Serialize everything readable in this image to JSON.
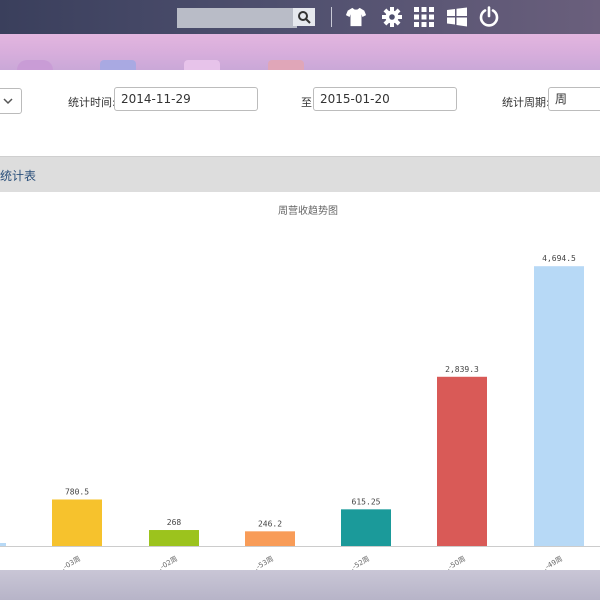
{
  "filters": {
    "start_label": "统计时间:",
    "start_value": "2014-11-29",
    "end_label": "至",
    "end_value": "2015-01-20",
    "period_label": "统计周期:",
    "period_value": "周"
  },
  "section": {
    "title": "统计表"
  },
  "chart_data": {
    "type": "bar",
    "title": "周营收趋势图",
    "categories": [
      "…-03周",
      "…-02周",
      "…-53周",
      "…-52周",
      "…-50周",
      "…-49周"
    ],
    "values": [
      780.5,
      268,
      246.2,
      615.25,
      2839.3,
      4694.5
    ],
    "data_labels": [
      "780.5",
      "268",
      "246.2",
      "615.25",
      "2,839.3",
      "4,694.5"
    ],
    "colors": [
      "#f6c22d",
      "#9cc31d",
      "#f89c58",
      "#1b9a9a",
      "#d95a57",
      "#b7d9f6"
    ],
    "ylim": [
      0,
      5000
    ],
    "grid": false,
    "legend": "none"
  }
}
